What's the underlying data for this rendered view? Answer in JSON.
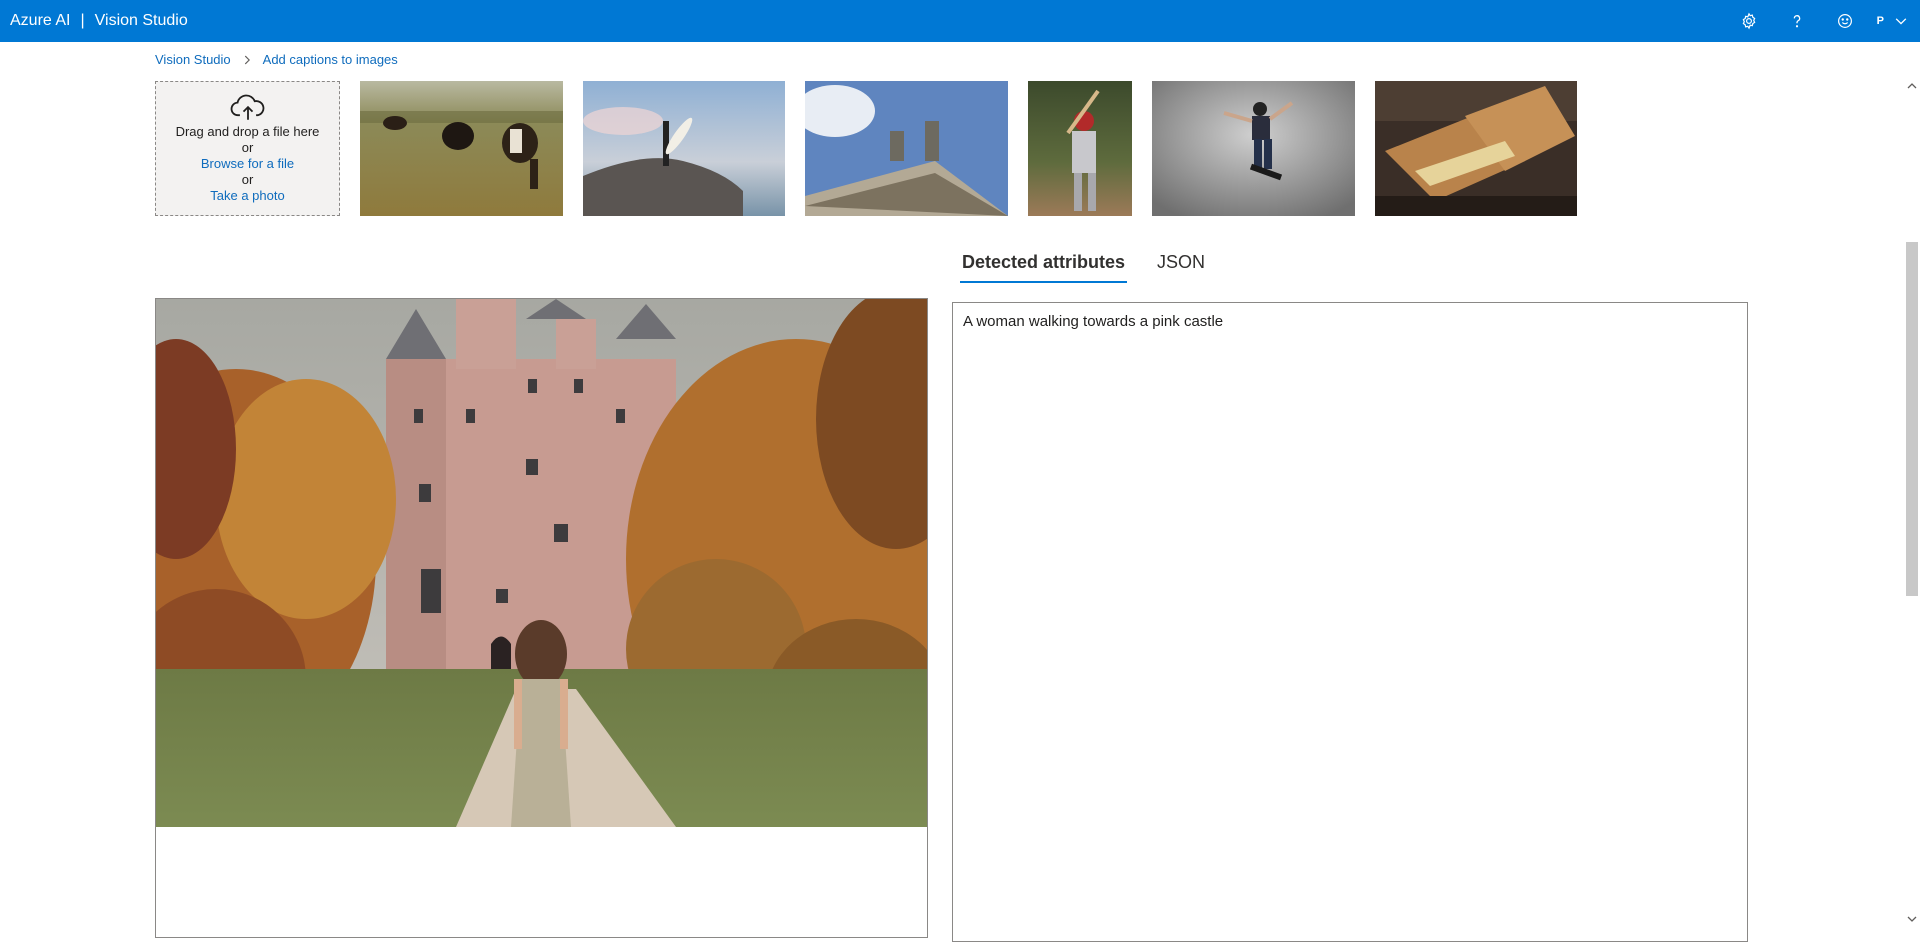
{
  "topbar": {
    "brand": "Azure AI",
    "separator": "|",
    "product": "Vision Studio",
    "icons": [
      "gear-icon",
      "help-icon",
      "feedback-smiley-icon",
      "chevron-down-icon"
    ],
    "account_initial": "P",
    "bar_color": "#0078d4"
  },
  "breadcrumb": {
    "root": "Vision Studio",
    "current": "Add captions to images"
  },
  "upload": {
    "drag_text": "Drag and drop a file here",
    "or_1": "or",
    "browse": "Browse for a file",
    "or_2": "or",
    "photo": "Take a photo",
    "icon": "cloud-upload-icon"
  },
  "samples": [
    {
      "name": "cows-grazing"
    },
    {
      "name": "surfer-on-rock"
    },
    {
      "name": "building-statues"
    },
    {
      "name": "baseball-batter"
    },
    {
      "name": "skateboarder"
    },
    {
      "name": "grilled-sandwich"
    }
  ],
  "tabs": [
    {
      "label": "Detected attributes",
      "active": true
    },
    {
      "label": "JSON",
      "active": false
    }
  ],
  "result": {
    "caption": "A woman walking towards a pink castle"
  },
  "colors": {
    "accent": "#0078d4",
    "link": "#0f6cbd"
  }
}
